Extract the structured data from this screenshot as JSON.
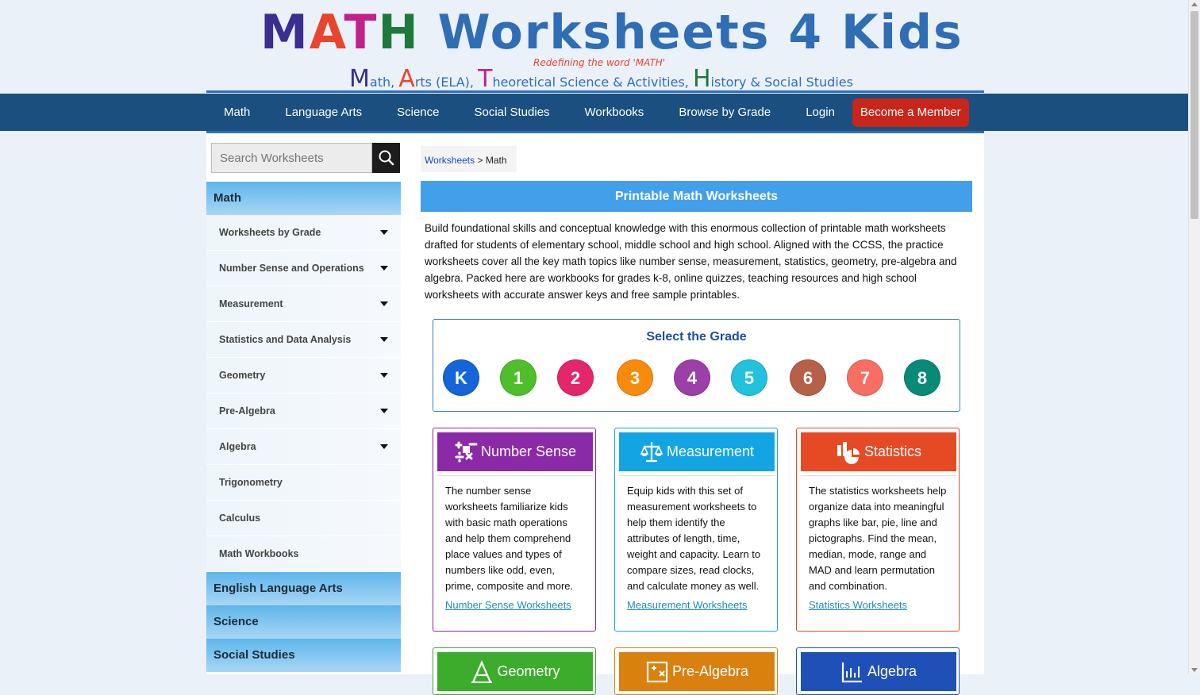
{
  "header": {
    "logo_parts": [
      "M",
      "A",
      "T",
      "H",
      " Worksheets 4 Kids"
    ],
    "tagline_sub": "Redefining the word 'MATH'",
    "tagline": {
      "m": "M",
      "m_rest": "ath,",
      "a": "A",
      "a_rest": "rts (ELA),",
      "t": "T",
      "t_rest": "heoretical Science & Activities,",
      "h": "H",
      "h_rest": "istory  & Social Studies"
    }
  },
  "nav": {
    "items": [
      "Math",
      "Language Arts",
      "Science",
      "Social Studies",
      "Workbooks",
      "Browse by Grade",
      "Login"
    ],
    "member": "Become a Member"
  },
  "search": {
    "placeholder": "Search Worksheets"
  },
  "sidebar": {
    "math_head": "Math",
    "items": [
      {
        "label": "Worksheets by Grade",
        "arrow": true
      },
      {
        "label": "Number Sense and Operations",
        "arrow": true
      },
      {
        "label": "Measurement",
        "arrow": true
      },
      {
        "label": "Statistics and Data Analysis",
        "arrow": true
      },
      {
        "label": "Geometry",
        "arrow": true
      },
      {
        "label": "Pre-Algebra",
        "arrow": true
      },
      {
        "label": "Algebra",
        "arrow": true
      },
      {
        "label": "Trigonometry",
        "arrow": false
      },
      {
        "label": "Calculus",
        "arrow": false
      },
      {
        "label": "Math Workbooks",
        "arrow": false
      }
    ],
    "other_heads": [
      "English Language Arts",
      "Science",
      "Social Studies"
    ]
  },
  "breadcrumb": {
    "link": "Worksheets",
    "sep": " > ",
    "current": "Math"
  },
  "page_title": "Printable Math Worksheets",
  "intro": "Build foundational skills and conceptual knowledge with this enormous collection of printable math worksheets drafted for students of elementary school, middle school and high school. Aligned with the CCSS, the practice worksheets cover all the key math topics like number sense, measurement, statistics, geometry, pre-algebra and algebra. Packed here are workbooks for grades k-8, online quizzes, teaching resources and high school worksheets with accurate answer keys and free sample printables.",
  "grades": {
    "title": "Select the Grade",
    "items": [
      {
        "label": "K",
        "color": "#1565d8"
      },
      {
        "label": "1",
        "color": "#4ebf2b"
      },
      {
        "label": "2",
        "color": "#e5266b"
      },
      {
        "label": "3",
        "color": "#f98b0c"
      },
      {
        "label": "4",
        "color": "#9c3fa8"
      },
      {
        "label": "5",
        "color": "#22c1dc"
      },
      {
        "label": "6",
        "color": "#b66048"
      },
      {
        "label": "7",
        "color": "#f86e63"
      },
      {
        "label": "8",
        "color": "#078a76"
      }
    ]
  },
  "cards": [
    {
      "title": "Number Sense",
      "color": "#8a2aa6",
      "border": "#8a2aa6",
      "icon": "number-sense-icon",
      "body": "The number sense worksheets familiarize kids with basic math operations and help them comprehend place values and types of numbers like odd, even, prime, composite and more.",
      "link": "Number Sense Worksheets"
    },
    {
      "title": "Measurement",
      "color": "#13a5e3",
      "border": "#13a5e3",
      "icon": "scale-icon",
      "body": "Equip kids with this set of measurement worksheets to help them identify the attributes of length, time, weight and capacity. Learn to compare sizes, read clocks, and calculate money as well.",
      "link": "Measurement Worksheets"
    },
    {
      "title": "Statistics",
      "color": "#e64a24",
      "border": "#e64a24",
      "icon": "statistics-icon",
      "body": "The statistics worksheets help organize data into meaningful graphs like bar, pie, line and pictographs. Find the mean, median, mode, range and MAD and learn permutation and combination.",
      "link": "Statistics Worksheets"
    },
    {
      "title": "Geometry",
      "color": "#3bac2c",
      "border": "#3bac2c",
      "icon": "geometry-icon",
      "body": "",
      "link": ""
    },
    {
      "title": "Pre-Algebra",
      "color": "#d9800f",
      "border": "#d9800f",
      "icon": "pre-algebra-icon",
      "body": "",
      "link": ""
    },
    {
      "title": "Algebra",
      "color": "#1e50b8",
      "border": "#1e50b8",
      "icon": "algebra-icon",
      "body": "",
      "link": ""
    }
  ]
}
